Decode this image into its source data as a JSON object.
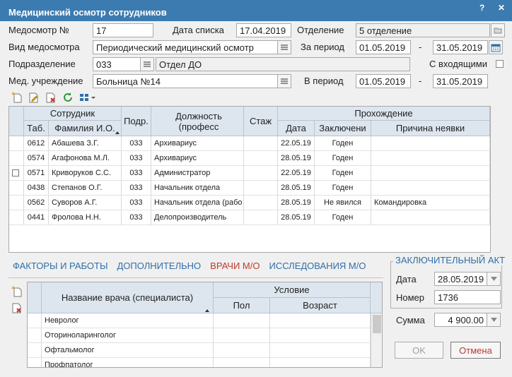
{
  "window": {
    "title": "Медицинский осмотр сотрудников",
    "help_glyph": "?",
    "close_glyph": "✕"
  },
  "form": {
    "num_label": "Медосмотр №",
    "num_value": "17",
    "list_date_label": "Дата списка",
    "list_date_value": "17.04.2019",
    "dept_label": "Отделение",
    "dept_value": "5 отделение",
    "type_label": "Вид медосмотра",
    "type_value": "Периодический медицинский осмотр",
    "period_label": "За период",
    "period_from": "01.05.2019",
    "period_dash": "-",
    "period_to": "31.05.2019",
    "sub_label": "Подразделение",
    "sub_code": "033",
    "sub_name": "Отдел ДО",
    "incoming_label": "С входящими",
    "inst_label": "Мед. учреждение",
    "inst_value": "Больница №14",
    "in_period_label": "В период",
    "in_period_from": "01.05.2019",
    "in_period_dash": "-",
    "in_period_to": "31.05.2019"
  },
  "employees": {
    "headers": {
      "employee": "Сотрудник",
      "tab": "Таб.",
      "name": "Фамилия И.О.",
      "sub": "Подр.",
      "position": "Должность (професс",
      "stazh": "Стаж",
      "passing": "Прохождение",
      "date": "Дата",
      "conclusion": "Заключени",
      "reason": "Причина неявки"
    },
    "rows": [
      {
        "tab": "0612",
        "name": "Абашева З.Г.",
        "sub": "033",
        "position": "Архивариус",
        "date": "22.05.19",
        "conclusion": "Годен",
        "reason": ""
      },
      {
        "tab": "0574",
        "name": "Агафонова М.Л.",
        "sub": "033",
        "position": "Архивариус",
        "date": "28.05.19",
        "conclusion": "Годен",
        "reason": ""
      },
      {
        "tab": "0571",
        "name": "Криворуков С.С.",
        "sub": "033",
        "position": "Администратор",
        "date": "22.05.19",
        "conclusion": "Годен",
        "reason": ""
      },
      {
        "tab": "0438",
        "name": "Степанов О.Г.",
        "sub": "033",
        "position": "Начальник отдела",
        "date": "28.05.19",
        "conclusion": "Годен",
        "reason": ""
      },
      {
        "tab": "0562",
        "name": "Суворов А.Г.",
        "sub": "033",
        "position": "Начальник отдела (рабо",
        "date": "28.05.19",
        "conclusion": "Не явился",
        "reason": "Командировка"
      },
      {
        "tab": "0441",
        "name": "Фролова Н.Н.",
        "sub": "033",
        "position": "Делопроизводитель",
        "date": "28.05.19",
        "conclusion": "Годен",
        "reason": ""
      }
    ]
  },
  "tabs": [
    "ФАКТОРЫ И РАБОТЫ",
    "ДОПОЛНИТЕЛЬНО",
    "ВРАЧИ М/О",
    "ИССЛЕДОВАНИЯ М/О"
  ],
  "doctors": {
    "headers": {
      "name": "Название врача (специалиста)",
      "condition": "Условие",
      "sex": "Пол",
      "age": "Возраст"
    },
    "rows": [
      "Невролог",
      "Оториноларинголог",
      "Офтальмолог",
      "Профпатолог"
    ]
  },
  "final_act": {
    "title": "ЗАКЛЮЧИТЕЛЬНЫЙ АКТ",
    "date_label": "Дата",
    "date_value": "28.05.2019",
    "number_label": "Номер",
    "number_value": "1736",
    "sum_label": "Сумма",
    "sum_value": "4 900.00"
  },
  "buttons": {
    "ok": "OK",
    "cancel": "Отмена"
  }
}
